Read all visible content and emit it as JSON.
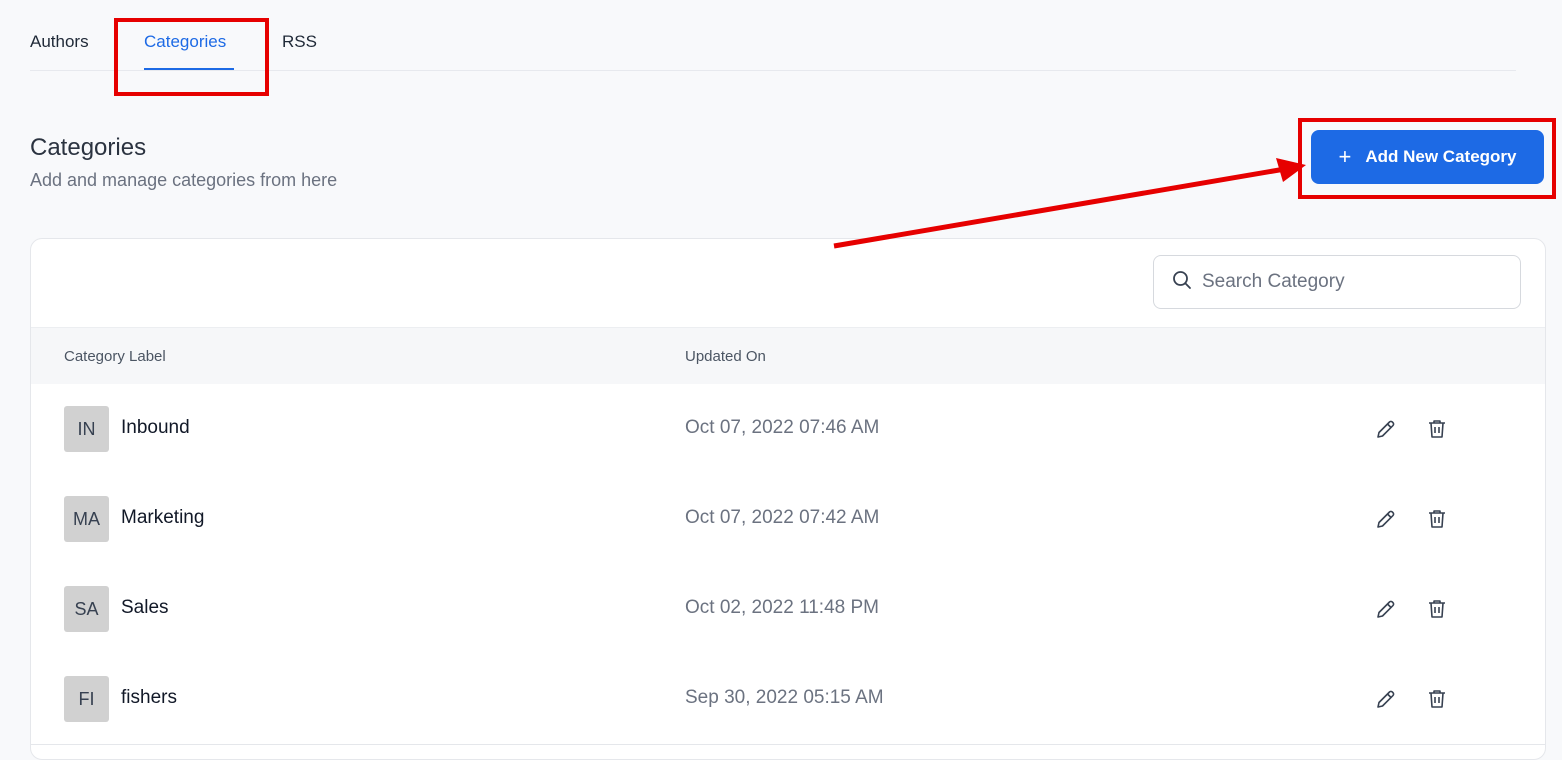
{
  "tabs": [
    {
      "label": "Authors"
    },
    {
      "label": "Categories",
      "active": true
    },
    {
      "label": "RSS"
    }
  ],
  "header": {
    "title": "Categories",
    "subtitle": "Add and manage categories from here",
    "add_button_label": "Add New Category"
  },
  "search": {
    "placeholder": "Search Category"
  },
  "table": {
    "columns": [
      "Category Label",
      "Updated On"
    ],
    "rows": [
      {
        "initials": "IN",
        "label": "Inbound",
        "updated": "Oct 07, 2022 07:46 AM"
      },
      {
        "initials": "MA",
        "label": "Marketing",
        "updated": "Oct 07, 2022 07:42 AM"
      },
      {
        "initials": "SA",
        "label": "Sales",
        "updated": "Oct 02, 2022 11:48 PM"
      },
      {
        "initials": "FI",
        "label": "fishers",
        "updated": "Sep 30, 2022 05:15 AM"
      }
    ]
  },
  "icons": [
    "search-icon",
    "plus-icon",
    "edit-pencil-icon",
    "trash-icon"
  ],
  "colors": {
    "accent": "#1d6ae5",
    "annotation": "#e60000",
    "avatar_bg": "#d1d1d1"
  }
}
